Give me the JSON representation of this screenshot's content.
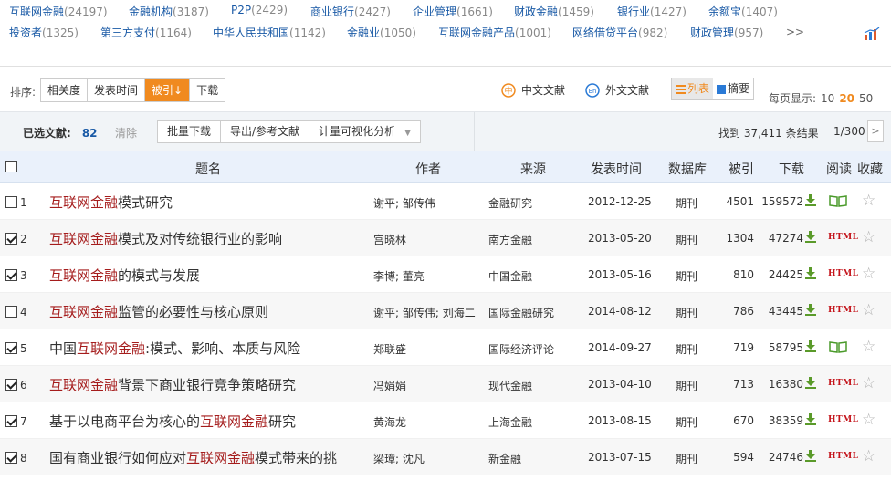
{
  "tags": {
    "row1": [
      {
        "name": "互联网金融",
        "count": "(24197)"
      },
      {
        "name": "金融机构",
        "count": "(3187)"
      },
      {
        "name": "P2P",
        "count": "(2429)"
      },
      {
        "name": "商业银行",
        "count": "(2427)"
      },
      {
        "name": "企业管理",
        "count": "(1661)"
      },
      {
        "name": "财政金融",
        "count": "(1459)"
      },
      {
        "name": "银行业",
        "count": "(1427)"
      },
      {
        "name": "余额宝",
        "count": "(1407)"
      }
    ],
    "row2": [
      {
        "name": "投资者",
        "count": "(1325)"
      },
      {
        "name": "第三方支付",
        "count": "(1164)"
      },
      {
        "name": "中华人民共和国",
        "count": "(1142)"
      },
      {
        "name": "金融业",
        "count": "(1050)"
      },
      {
        "name": "互联网金融产品",
        "count": "(1001)"
      },
      {
        "name": "网络借贷平台",
        "count": "(982)"
      },
      {
        "name": "财政管理",
        "count": "(957)"
      }
    ],
    "more": ">>",
    "chart_icon": "bar-chart-icon"
  },
  "sortbar": {
    "label": "排序:",
    "buttons": [
      "相关度",
      "发表时间",
      "被引",
      "下载"
    ],
    "active_index": 2,
    "active_arrow": "↓",
    "chinese_docs": "中文文献",
    "foreign_docs": "外文文献",
    "view_list": "列表",
    "view_abstract": "摘要",
    "per_page_label": "每页显示:",
    "per_page_options": [
      "10",
      "20",
      "50"
    ],
    "per_page_selected": "20"
  },
  "selection": {
    "label": "已选文献:",
    "count": "82",
    "clear": "清除",
    "batch_download": "批量下载",
    "export": "导出/参考文献",
    "visualize": "计量可视化分析",
    "dropdown_caret": "▼",
    "found": "找到 37,411 条结果",
    "page": "1/300",
    "next": ">"
  },
  "table": {
    "headers": {
      "title": "题名",
      "author": "作者",
      "source": "来源",
      "date": "发表时间",
      "db": "数据库",
      "cite": "被引",
      "download": "下载",
      "read": "阅读",
      "fav": "收藏"
    },
    "rows": [
      {
        "num": "1",
        "checked": false,
        "pre": "",
        "kw": "互联网金融",
        "post": "模式研究",
        "author": "谢平; 邹传伟",
        "source": "金融研究",
        "date": "2012-12-25",
        "db": "期刊",
        "cite": "4501",
        "download": "159572",
        "read": "book"
      },
      {
        "num": "2",
        "checked": true,
        "pre": "",
        "kw": "互联网金融",
        "post": "模式及对传统银行业的影响",
        "author": "宫晓林",
        "source": "南方金融",
        "date": "2013-05-20",
        "db": "期刊",
        "cite": "1304",
        "download": "47274",
        "read": "HTML"
      },
      {
        "num": "3",
        "checked": true,
        "pre": "",
        "kw": "互联网金融",
        "post": "的模式与发展",
        "author": "李博; 董亮",
        "source": "中国金融",
        "date": "2013-05-16",
        "db": "期刊",
        "cite": "810",
        "download": "24425",
        "read": "HTML"
      },
      {
        "num": "4",
        "checked": false,
        "pre": "",
        "kw": "互联网金融",
        "post": "监管的必要性与核心原则",
        "author": "谢平; 邹传伟; 刘海二",
        "source": "国际金融研究",
        "date": "2014-08-12",
        "db": "期刊",
        "cite": "786",
        "download": "43445",
        "read": "HTML"
      },
      {
        "num": "5",
        "checked": true,
        "pre": "中国",
        "kw": "互联网金融",
        "post": ":模式、影响、本质与风险",
        "author": "郑联盛",
        "source": "国际经济评论",
        "date": "2014-09-27",
        "db": "期刊",
        "cite": "719",
        "download": "58795",
        "read": "book"
      },
      {
        "num": "6",
        "checked": true,
        "pre": "",
        "kw": "互联网金融",
        "post": "背景下商业银行竞争策略研究",
        "author": "冯娟娟",
        "source": "现代金融",
        "date": "2013-04-10",
        "db": "期刊",
        "cite": "713",
        "download": "16380",
        "read": "HTML"
      },
      {
        "num": "7",
        "checked": true,
        "pre": "基于以电商平台为核心的",
        "kw": "互联网金融",
        "post": "研究",
        "author": "黄海龙",
        "source": "上海金融",
        "date": "2013-08-15",
        "db": "期刊",
        "cite": "670",
        "download": "38359",
        "read": "HTML"
      },
      {
        "num": "8",
        "checked": true,
        "pre": "国有商业银行如何应对",
        "kw": "互联网金融",
        "post": "模式带来的挑",
        "author": "梁璋; 沈凡",
        "source": "新金融",
        "date": "2013-07-15",
        "db": "期刊",
        "cite": "594",
        "download": "24746",
        "read": "HTML"
      }
    ]
  }
}
